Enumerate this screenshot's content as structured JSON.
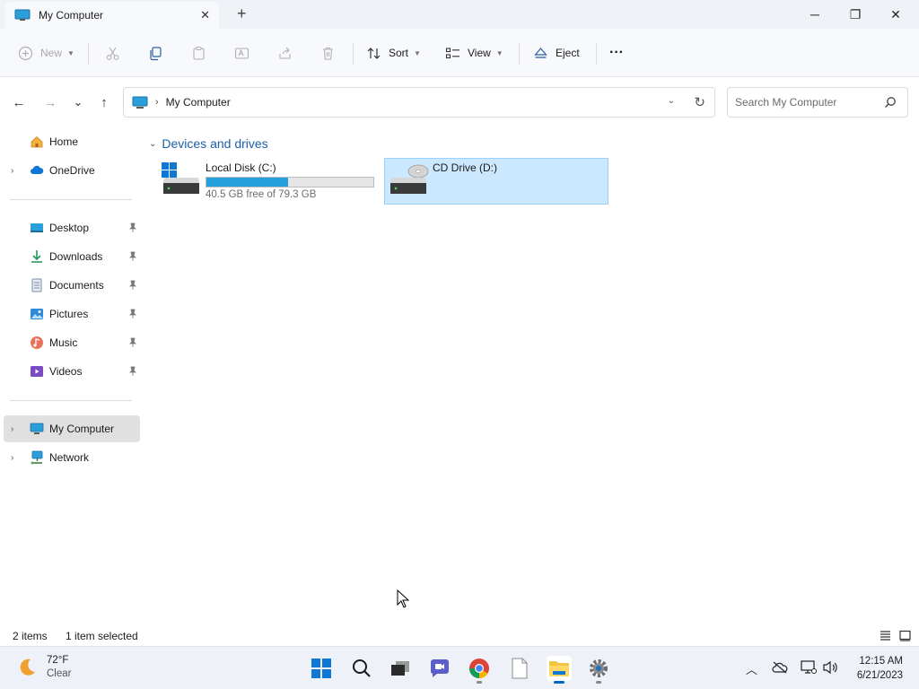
{
  "window": {
    "tab_title": "My Computer",
    "tab_close": "✕",
    "new_tab": "+",
    "minimize": "─",
    "restore": "❐",
    "close": "✕"
  },
  "toolbar": {
    "new_label": "New",
    "sort_label": "Sort",
    "view_label": "View",
    "eject_label": "Eject",
    "more_label": "···"
  },
  "nav": {
    "back": "←",
    "forward": "→",
    "recent": "⌄",
    "up": "↑"
  },
  "address": {
    "breadcrumb": "My Computer",
    "separator": "›",
    "dropdown": "⌄",
    "refresh": "↻"
  },
  "search": {
    "placeholder": "Search My Computer"
  },
  "sidebar": {
    "items": [
      {
        "label": "Home"
      },
      {
        "label": "OneDrive"
      },
      {
        "label": "Desktop"
      },
      {
        "label": "Downloads"
      },
      {
        "label": "Documents"
      },
      {
        "label": "Pictures"
      },
      {
        "label": "Music"
      },
      {
        "label": "Videos"
      },
      {
        "label": "My Computer"
      },
      {
        "label": "Network"
      }
    ],
    "expand_glyph": "›"
  },
  "content": {
    "group_title": "Devices and drives",
    "drives": [
      {
        "name": "Local Disk (C:)",
        "free_text": "40.5 GB free of 79.3 GB",
        "used_fraction": 0.49
      },
      {
        "name": "CD Drive (D:)"
      }
    ]
  },
  "status": {
    "item_count": "2 items",
    "selection": "1 item selected"
  },
  "taskbar": {
    "temperature": "72°F",
    "condition": "Clear",
    "time": "12:15 AM",
    "date": "6/21/2023"
  },
  "colors": {
    "accent": "#0067c0",
    "selection": "#cce8ff",
    "capacity_bar": "#26a0da",
    "group_header": "#1b5fa8"
  }
}
